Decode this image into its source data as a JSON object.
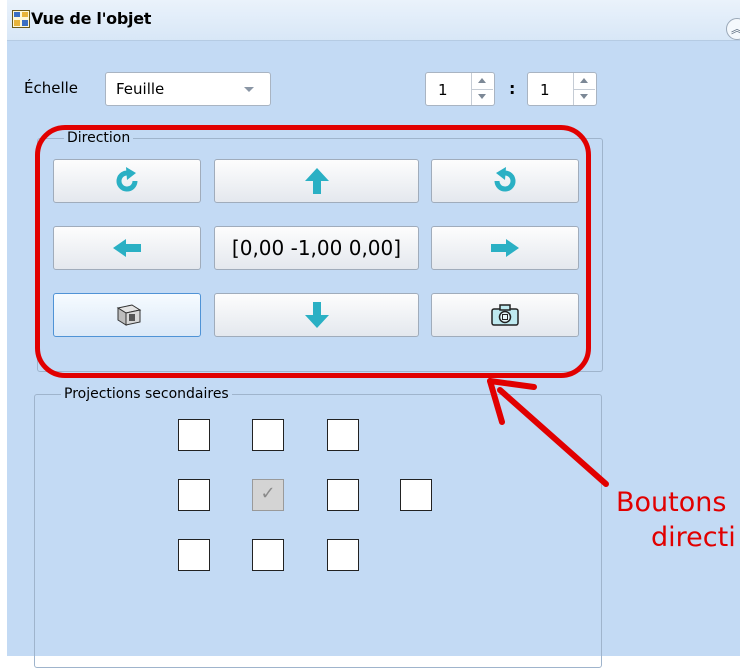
{
  "panel": {
    "title": "Vue de l'objet"
  },
  "scale": {
    "label": "Échelle",
    "value": "Feuille",
    "numerator": "1",
    "separator": ":",
    "denominator": "1"
  },
  "direction": {
    "legend": "Direction",
    "vector": "[0,00 -1,00 0,00]"
  },
  "secondary": {
    "legend": "Projections secondaires"
  },
  "annotation": {
    "line1": "Boutons",
    "line2": "directi"
  },
  "colors": {
    "accent_red": "#e10000",
    "arrow_teal": "#2ab0c4",
    "panel_bg": "#c3daf4"
  }
}
